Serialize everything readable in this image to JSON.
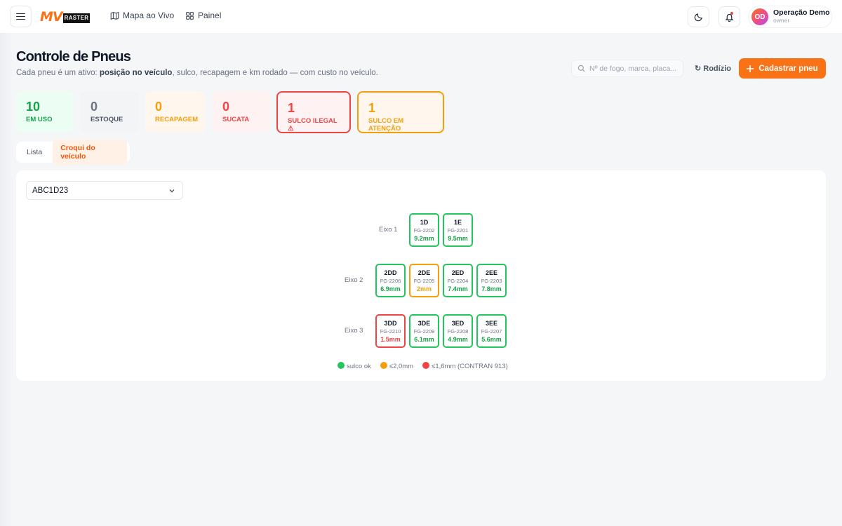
{
  "brand": {
    "logo_mark": "MV",
    "logo_word": "RASTER"
  },
  "nav": [
    {
      "label": "Mapa ao Vivo",
      "icon": "map-icon"
    },
    {
      "label": "Painel",
      "icon": "grid-icon"
    }
  ],
  "user": {
    "initials": "OD",
    "name": "Operação Demo",
    "role": "owner"
  },
  "header": {
    "title": "Controle de Pneus",
    "subtitle_pre": "Cada pneu é um ativo: ",
    "subtitle_bold": "posição no veículo",
    "subtitle_post": ", sulco, recapagem e km rodado — com custo no veículo.",
    "search_placeholder": "Nº de fogo, marca, placa...",
    "rodizio_label": "↻ Rodízio",
    "cadastrar_label": "Cadastrar pneu"
  },
  "stats": [
    {
      "value": "10",
      "label": "EM USO"
    },
    {
      "value": "0",
      "label": "ESTOQUE"
    },
    {
      "value": "0",
      "label": "RECAPAGEM"
    },
    {
      "value": "0",
      "label": "SUCATA"
    },
    {
      "value": "1",
      "label": "SULCO ILEGAL ⚠"
    },
    {
      "value": "1",
      "label": "SULCO EM ATENÇÃO"
    }
  ],
  "tabs": [
    {
      "label": "Lista",
      "active": false
    },
    {
      "label": "Croqui do veículo",
      "active": true
    }
  ],
  "vehicle_select": {
    "value": "ABC1D23"
  },
  "axles": [
    {
      "label": "Eixo 1",
      "tyres": [
        {
          "pos": "1D",
          "fg": "FG-2202",
          "mm": "9.2mm",
          "status": "ok"
        },
        {
          "pos": "1E",
          "fg": "FG-2201",
          "mm": "9.5mm",
          "status": "ok"
        }
      ]
    },
    {
      "label": "Eixo 2",
      "tyres": [
        {
          "pos": "2DD",
          "fg": "FG-2206",
          "mm": "6.9mm",
          "status": "ok"
        },
        {
          "pos": "2DE",
          "fg": "FG-2205",
          "mm": "2mm",
          "status": "warn"
        },
        {
          "pos": "2ED",
          "fg": "FG-2204",
          "mm": "7.4mm",
          "status": "ok"
        },
        {
          "pos": "2EE",
          "fg": "FG-2203",
          "mm": "7.8mm",
          "status": "ok"
        }
      ]
    },
    {
      "label": "Eixo 3",
      "tyres": [
        {
          "pos": "3DD",
          "fg": "FG-2210",
          "mm": "1.5mm",
          "status": "bad"
        },
        {
          "pos": "3DE",
          "fg": "FG-2209",
          "mm": "6.1mm",
          "status": "ok"
        },
        {
          "pos": "3ED",
          "fg": "FG-2208",
          "mm": "4.9mm",
          "status": "ok"
        },
        {
          "pos": "3EE",
          "fg": "FG-2207",
          "mm": "5.6mm",
          "status": "ok"
        }
      ]
    }
  ],
  "legend": [
    {
      "label": "sulco ok",
      "color": "#22c55e"
    },
    {
      "label": "≤2,0mm",
      "color": "#f59e0b"
    },
    {
      "label": "≤1,6mm (CONTRAN 913)",
      "color": "#ef4444"
    }
  ],
  "colors": {
    "accent": "#f97316",
    "ok": "#22c55e",
    "warn": "#f59e0b",
    "bad": "#ef4444"
  }
}
